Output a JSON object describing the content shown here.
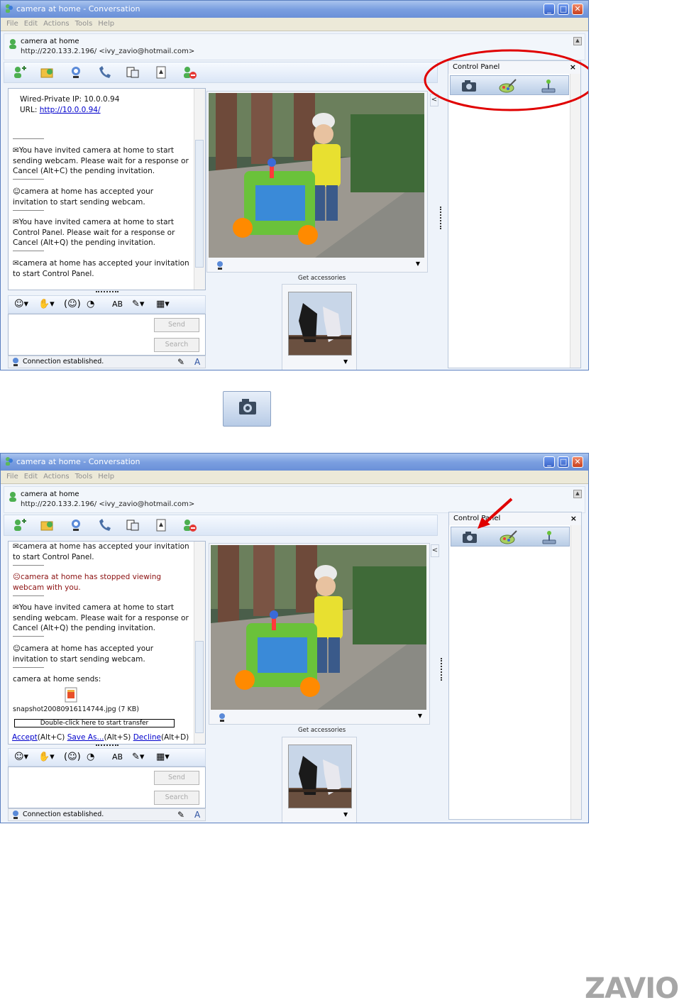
{
  "window": {
    "title": "camera at home - Conversation",
    "menu": [
      "File",
      "Edit",
      "Actions",
      "Tools",
      "Help"
    ],
    "controls": [
      "_",
      "□",
      "✕"
    ]
  },
  "contact": {
    "name": "camera at home",
    "address": "http://220.133.2.196/ <ivy_zavio@hotmail.com>"
  },
  "screen1": {
    "chat": {
      "ip_line": "Wired-Private IP: 10.0.0.94",
      "url_label": "URL:",
      "url_link": "http://10.0.0.94/",
      "msg1": "You have invited camera at home to start sending webcam. Please wait for a response or Cancel (Alt+C) the pending invitation.",
      "msg2": "camera at home has accepted your invitation to start sending webcam.",
      "msg3": "You have invited camera at home to start Control Panel. Please wait for a response or Cancel (Alt+Q) the pending invitation.",
      "msg4": "camera at home has accepted your invitation to start Control Panel."
    }
  },
  "screen2": {
    "chat": {
      "msg1": "camera at home has accepted your invitation to start Control Panel.",
      "msg2": "camera at home has stopped viewing webcam with you.",
      "msg3": "You have invited camera at home to start sending webcam. Please wait for a response or Cancel (Alt+Q) the pending invitation.",
      "msg4": "camera at home has accepted your invitation to start sending webcam.",
      "sends": "camera at home sends:",
      "file": "snapshot20080916114744.jpg (7 KB)",
      "transfer_hint": "Double-click here to start transfer",
      "accept": "Accept",
      "accept_key": "(Alt+C)",
      "saveas": "Save As...",
      "saveas_key": "(Alt+S)",
      "decline": "Decline",
      "decline_key": "(Alt+D)"
    }
  },
  "input": {
    "send_label": "Send",
    "search_label": "Search"
  },
  "status": {
    "text": "Connection established."
  },
  "accessories": {
    "label": "Get accessories"
  },
  "control_panel": {
    "title": "Control Panel",
    "close": "×"
  },
  "logo": {
    "text": "ZAVIO"
  },
  "colors": {
    "titlebar": "#7b9fe0",
    "annotation_red": "#e00000",
    "link": "#0000cc"
  }
}
